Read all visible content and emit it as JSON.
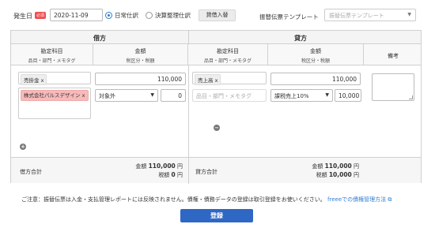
{
  "topbar": {
    "date_label": "発生日",
    "required_badge": "必須",
    "date_value": "2020-11-09",
    "radio_normal": "日常仕訳",
    "radio_closing": "決算整理仕訳",
    "balance_button": "貸借入替",
    "template_label": "振替伝票テンプレート",
    "template_placeholder": "振替伝票テンプレート"
  },
  "table": {
    "debit_header": "借方",
    "credit_header": "貸方",
    "account_header": "勘定科目",
    "account_sub": "品目・部門・メモタグ",
    "amount_header": "金額",
    "amount_sub": "税区分・税額",
    "memo_header": "備考"
  },
  "row": {
    "debit_account_tag": "売掛金 x",
    "debit_partner_tag": "株式会社パルスデザイン x",
    "debit_amount": "110,000",
    "debit_tax_select": "対象外",
    "debit_tax_amount": "0",
    "credit_account_tag": "売上高 x",
    "credit_tags_placeholder": "品目・部門・メモタグ",
    "credit_amount": "110,000",
    "credit_tax_select": "課税売上10%",
    "credit_tax_amount": "10,000"
  },
  "footer": {
    "debit_total_label": "借方合計",
    "credit_total_label": "貸方合計",
    "amount_label": "金額",
    "tax_label": "税額",
    "debit_amount": "110,000",
    "debit_tax": "0",
    "credit_amount": "110,000",
    "credit_tax": "10,000",
    "yen": "円"
  },
  "notice": {
    "text": "ご注意：振替伝票は入金・支払管理レポートには反映されません。債権・債務データの登録は取引登録をお使いください。",
    "link": "freeeでの債権管理方法"
  },
  "submit_label": "登録",
  "colors": {
    "accent": "#2f67c4",
    "required": "#e94e4e",
    "tag_red": "#f7b9b9"
  }
}
